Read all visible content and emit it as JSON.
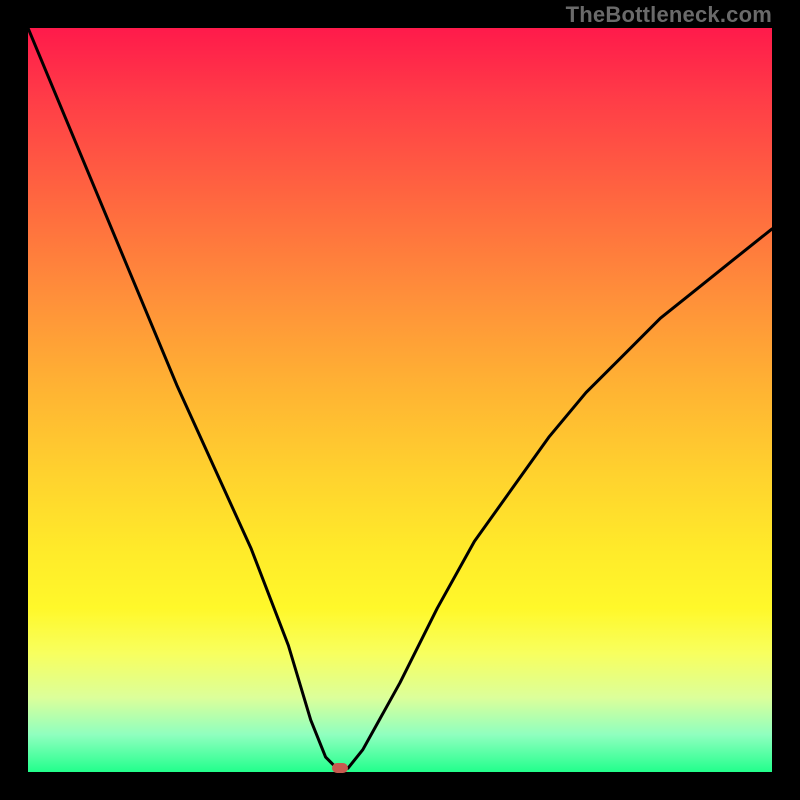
{
  "watermark": "TheBottleneck.com",
  "chart_data": {
    "type": "line",
    "title": "",
    "xlabel": "",
    "ylabel": "",
    "xlim": [
      0,
      100
    ],
    "ylim": [
      0,
      100
    ],
    "grid": false,
    "legend": false,
    "series": [
      {
        "name": "curve",
        "x": [
          0,
          5,
          10,
          15,
          20,
          25,
          30,
          35,
          38,
          40,
          41.5,
          43,
          45,
          50,
          55,
          60,
          65,
          70,
          75,
          80,
          85,
          90,
          95,
          100
        ],
        "y": [
          100,
          88,
          76,
          64,
          52,
          41,
          30,
          17,
          7,
          2,
          0.5,
          0.5,
          3,
          12,
          22,
          31,
          38,
          45,
          51,
          56,
          61,
          65,
          69,
          73
        ]
      }
    ],
    "marker": {
      "x": 42,
      "y": 0.5
    },
    "colors": {
      "curve": "#000000",
      "marker": "#c85a4f",
      "frame": "#000000",
      "gradient_top": "#ff1a4b",
      "gradient_bottom": "#22ff8c"
    }
  }
}
